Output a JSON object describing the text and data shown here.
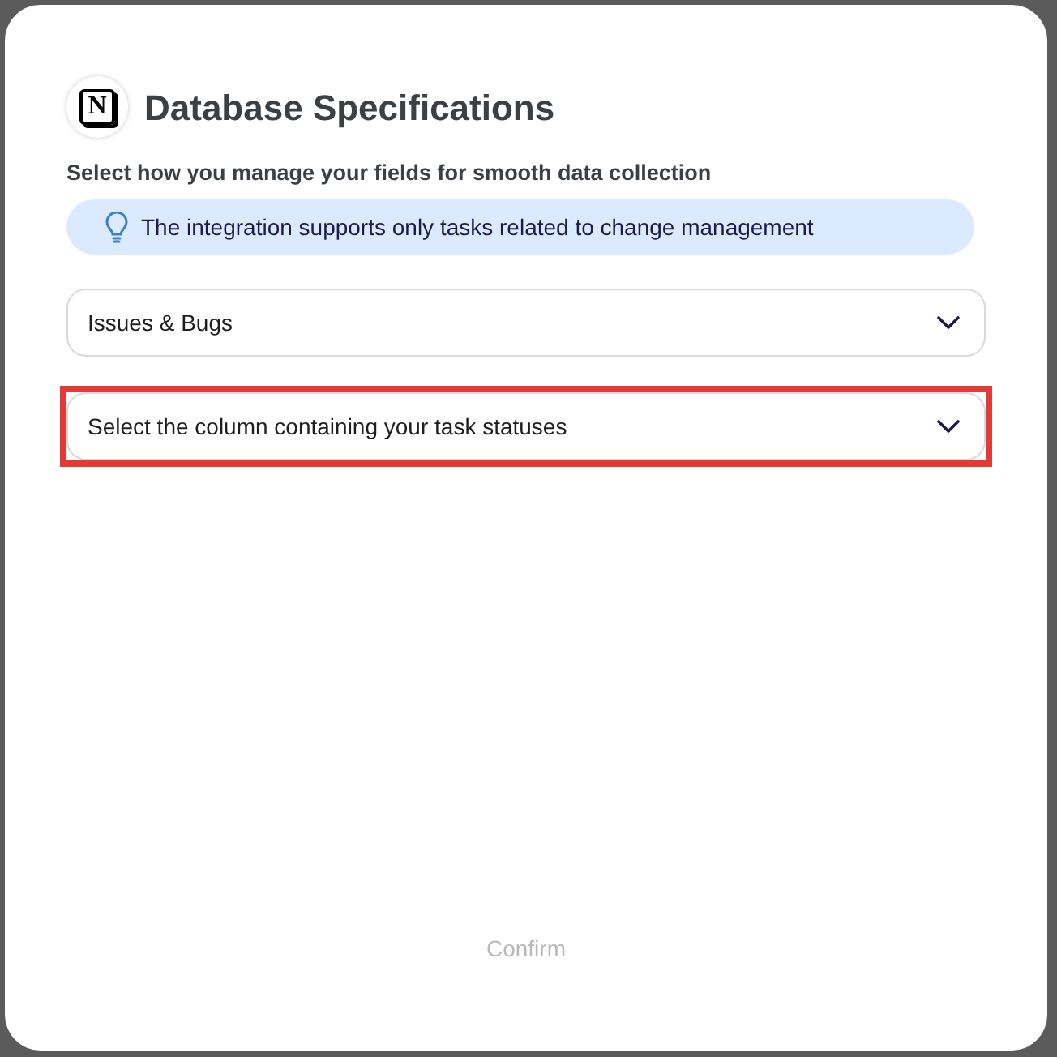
{
  "dialog": {
    "logo_letter": "N",
    "title": "Database Specifications",
    "subtitle": "Select how you manage your fields for smooth data collection",
    "info": "The integration supports only tasks related to change management",
    "selects": [
      {
        "value": "Issues & Bugs",
        "highlighted": false
      },
      {
        "value": "Select the column containing your task statuses",
        "highlighted": true
      }
    ],
    "confirm": {
      "label": "Confirm",
      "disabled": true
    }
  }
}
